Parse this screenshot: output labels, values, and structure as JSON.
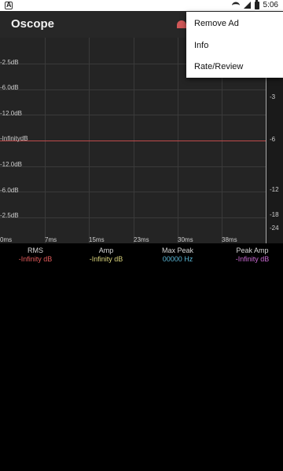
{
  "status_bar": {
    "time": "5:06"
  },
  "app_bar": {
    "title": "Oscope"
  },
  "menu": {
    "items": [
      "Remove Ad",
      "Info",
      "Rate/Review"
    ]
  },
  "scope": {
    "left_db_labels": [
      "-2.5dB",
      "-6.0dB",
      "-12.0dB",
      "-InfinitydB",
      "-12.0dB",
      "-6.0dB",
      "-2.5dB"
    ],
    "right_db_labels": [
      "-3",
      "-6",
      "-12",
      "-18",
      "-24"
    ],
    "time_labels": [
      "0ms",
      "7ms",
      "15ms",
      "23ms",
      "30ms",
      "38ms"
    ]
  },
  "stats": [
    {
      "name": "RMS",
      "value": "-Infinity dB",
      "color": "#e05a5a"
    },
    {
      "name": "Amp",
      "value": "-Infinity dB",
      "color": "#d8d27a"
    },
    {
      "name": "Max Peak",
      "value": "00000 Hz",
      "color": "#5bb7d6"
    },
    {
      "name": "Peak Amp",
      "value": "-Infinity dB",
      "color": "#c86ad1"
    }
  ]
}
